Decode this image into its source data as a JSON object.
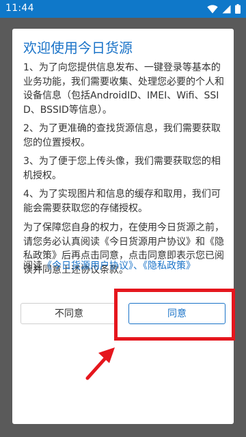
{
  "status_bar": {
    "time": "11:44",
    "icons": [
      "wifi-icon",
      "signal-icon",
      "battery-icon"
    ]
  },
  "dialog": {
    "title": "欢迎使用今日货源",
    "paragraphs": [
      "1、为了向您提供信息发布、一键登录等基本的业务功能，我们需要收集、处理您必要的个人和设备信息（包括AndroidID、IMEI、Wifi、SSID、BSSID等信息）。",
      "2、为了更准确的查找货源信息，我们需要获取您的位置授权。",
      "3、为了便于您上传头像，我们需要获取您的相机授权。",
      "4、为了实现图片和信息的缓存和取用，我们可能会需要获取您的存储授权。"
    ],
    "notice": "为了保障您自身的权力，在使用今日货源之前，请您务必认真阅读《今日货源用户协议》和《隐私政策》后再点击同意，点击同意即表示您已阅读并同意上述协议条款。",
    "read_prefix": "阅读",
    "user_agreement_link": "《今日货源用户协议》",
    "separator": "、",
    "privacy_policy_link": "《隐私政策》",
    "disagree_label": "不同意",
    "agree_label": "同意"
  },
  "colors": {
    "status_bar": "#0f78c9",
    "overlay": "#5a5a5a",
    "accent": "#1a73c8",
    "highlight": "#e5161d"
  }
}
